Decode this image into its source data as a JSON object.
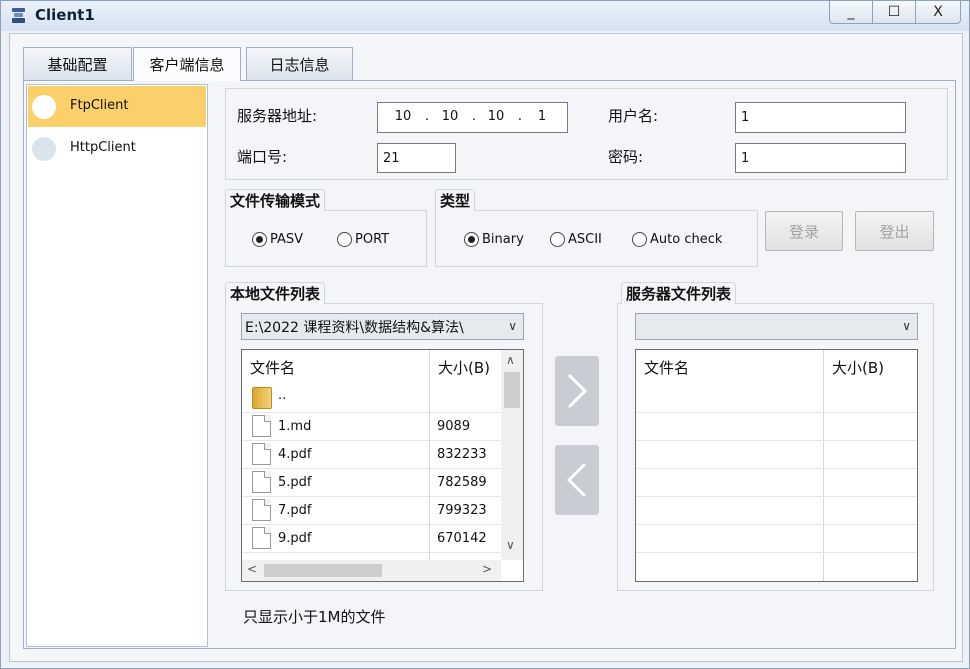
{
  "window": {
    "title": "Client1",
    "controls": {
      "minimize": "_",
      "maximize": "☐",
      "close": "X"
    }
  },
  "tabs": [
    {
      "label": "基础配置",
      "active": false
    },
    {
      "label": "客户端信息",
      "active": true
    },
    {
      "label": "日志信息",
      "active": false
    }
  ],
  "sidebar": {
    "items": [
      {
        "label": "FtpClient",
        "selected": true
      },
      {
        "label": "HttpClient",
        "selected": false
      }
    ]
  },
  "connection": {
    "server_label": "服务器地址:",
    "server_ip": [
      "10",
      "10",
      "10",
      "1"
    ],
    "port_label": "端口号:",
    "port_value": "21",
    "username_label": "用户名:",
    "username_value": "1",
    "password_label": "密码:",
    "password_value": "1"
  },
  "transfer_mode": {
    "title": "文件传输模式",
    "options": [
      {
        "label": "PASV",
        "selected": true
      },
      {
        "label": "PORT",
        "selected": false
      }
    ]
  },
  "type": {
    "title": "类型",
    "options": [
      {
        "label": "Binary",
        "selected": true
      },
      {
        "label": "ASCII",
        "selected": false
      },
      {
        "label": "Auto check",
        "selected": false
      }
    ]
  },
  "buttons": {
    "login": "登录",
    "logout": "登出"
  },
  "local_files": {
    "title": "本地文件列表",
    "path": "E:\\2022 课程资料\\数据结构&算法\\",
    "columns": {
      "name": "文件名",
      "size": "大小(B)"
    },
    "rows": [
      {
        "name": "..",
        "size": "",
        "icon": "folder-icon"
      },
      {
        "name": "1.md",
        "size": "9089",
        "icon": "file-icon"
      },
      {
        "name": "4.pdf",
        "size": "832233",
        "icon": "file-icon"
      },
      {
        "name": "5.pdf",
        "size": "782589",
        "icon": "file-icon"
      },
      {
        "name": "7.pdf",
        "size": "799323",
        "icon": "file-icon"
      },
      {
        "name": "9.pdf",
        "size": "670142",
        "icon": "file-icon"
      }
    ]
  },
  "server_files": {
    "title": "服务器文件列表",
    "path": "",
    "columns": {
      "name": "文件名",
      "size": "大小(B)"
    }
  },
  "footer_note": "只显示小于1M的文件"
}
